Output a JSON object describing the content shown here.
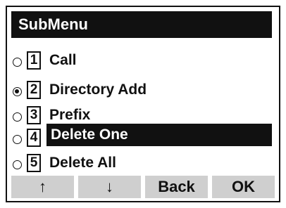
{
  "title": "SubMenu",
  "menu": {
    "items": [
      {
        "number": "1",
        "label": "Call",
        "checked": false,
        "selected": false
      },
      {
        "number": "2",
        "label": "Directory Add",
        "checked": true,
        "selected": false
      },
      {
        "number": "3",
        "label": "Prefix",
        "checked": false,
        "selected": false
      },
      {
        "number": "4",
        "label": "Delete One",
        "checked": false,
        "selected": true
      },
      {
        "number": "5",
        "label": "Delete All",
        "checked": false,
        "selected": false
      }
    ]
  },
  "softkeys": {
    "up": "↑",
    "down": "↓",
    "back": "Back",
    "ok": "OK"
  }
}
